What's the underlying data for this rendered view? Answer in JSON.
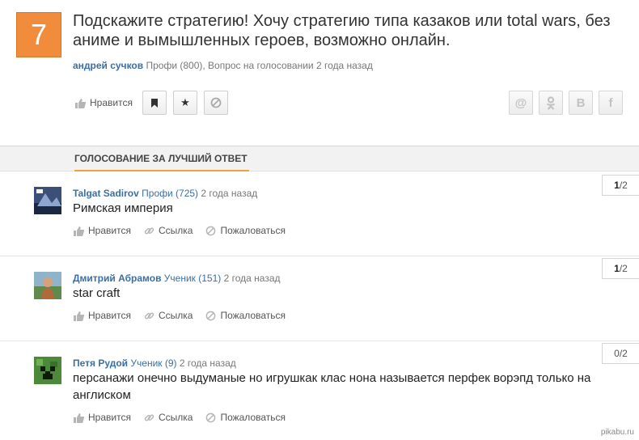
{
  "question": {
    "number": "7",
    "title": "Подскажите стратегию! Хочу стратегию типа казаков или total wars, без аниме и вымышленных героев, возможно онлайн.",
    "author": "андрей сучков",
    "meta": "Профи (800), Вопрос на голосовании 2 года назад",
    "like_label": "Нравится"
  },
  "share": [
    "@",
    "ok-icon",
    "В",
    "f"
  ],
  "section_title": "ГОЛОСОВАНИЕ ЗА ЛУЧШИЙ ОТВЕТ",
  "answers": [
    {
      "author": "Talgat Sadirov",
      "rank": "Профи (725)",
      "time": "2 года назад",
      "text": "Римская империя",
      "votes_strong": "1",
      "votes_rest": "/2"
    },
    {
      "author": "Дмитрий Абрамов",
      "rank": "Ученик (151)",
      "time": "2 года назад",
      "text": "star craft",
      "votes_strong": "1",
      "votes_rest": "/2"
    },
    {
      "author": "Петя Рудой",
      "rank": "Ученик (9)",
      "time": "2 года назад",
      "text": "персанажи онечно выдуманые но игрушкак клас нона называется перфек ворэпд только на англиском",
      "votes_strong": "",
      "votes_rest": "0/2"
    }
  ],
  "actions": {
    "like": "Нравится",
    "link": "Ссылка",
    "report": "Пожаловаться"
  },
  "watermark": "pikabu.ru"
}
